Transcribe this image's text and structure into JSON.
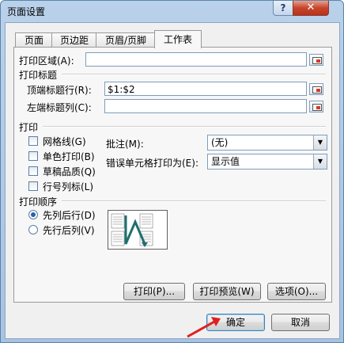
{
  "window": {
    "title": "页面设置",
    "help": "?",
    "close": "✕"
  },
  "tabs": [
    "页面",
    "页边距",
    "页眉/页脚",
    "工作表"
  ],
  "print_area": {
    "label": "打印区域(A):",
    "value": ""
  },
  "print_titles": {
    "heading": "打印标题",
    "top_rows_label": "顶端标题行(R):",
    "top_rows_value": "$1:$2",
    "left_cols_label": "左端标题列(C):",
    "left_cols_value": ""
  },
  "print": {
    "heading": "打印",
    "options": [
      "网格线(G)",
      "单色打印(B)",
      "草稿品质(Q)",
      "行号列标(L)"
    ],
    "comments_label": "批注(M):",
    "comments_value": "(无)",
    "errors_label": "错误单元格打印为(E):",
    "errors_value": "显示值"
  },
  "page_order": {
    "heading": "打印顺序",
    "options": [
      "先列后行(D)",
      "先行后列(V)"
    ],
    "selected": 0
  },
  "buttons": {
    "print": "打印(P)...",
    "preview": "打印预览(W)",
    "options": "选项(O)...",
    "ok": "确定",
    "cancel": "取消"
  },
  "colors": {
    "accent": "#2a5fa8",
    "annotation_arrow": "#e02020"
  }
}
